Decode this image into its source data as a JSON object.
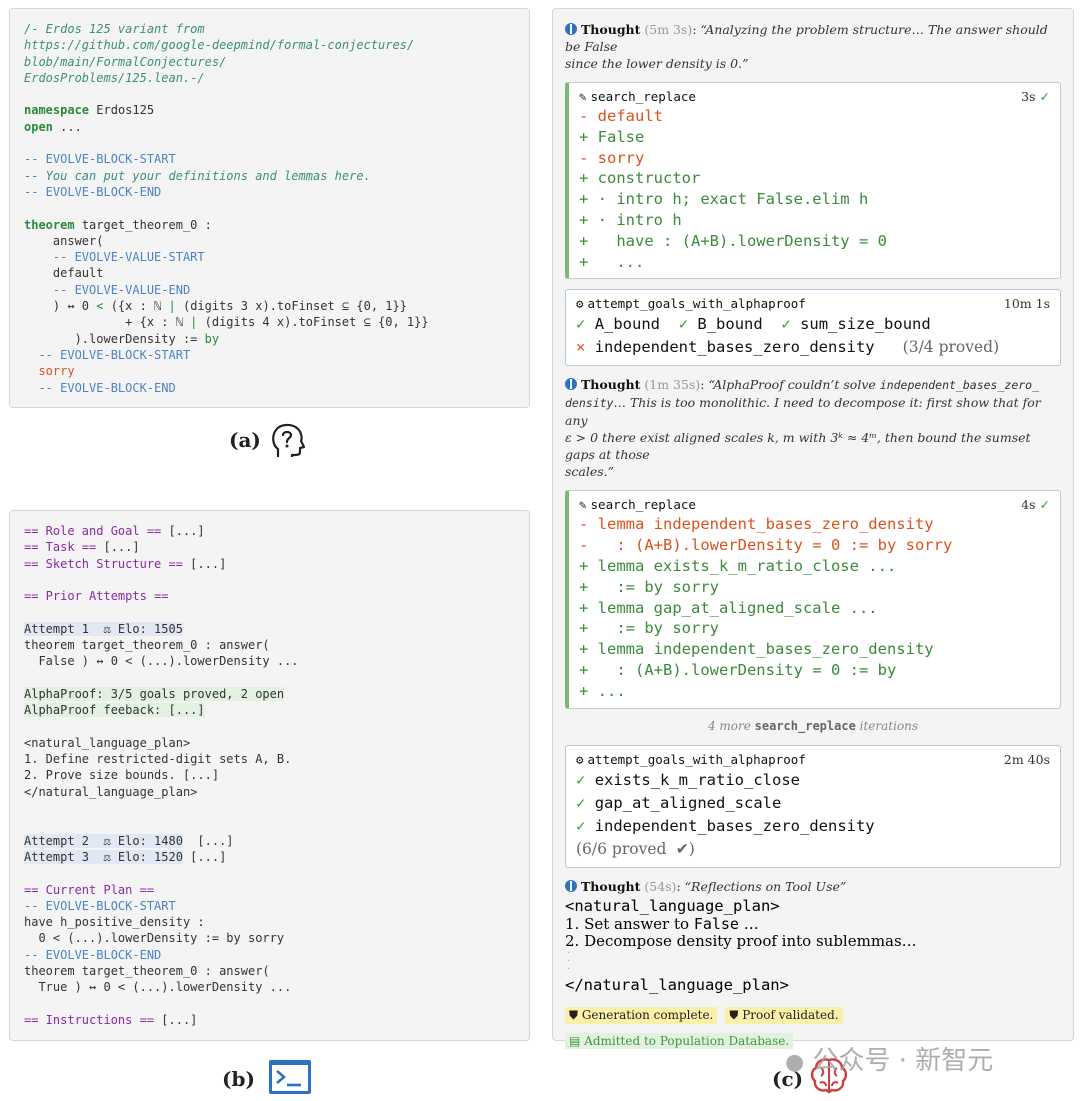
{
  "panel_a": {
    "header_comment": [
      "/- Erdos 125 variant from",
      "https://github.com/google-deepmind/formal-conjectures/",
      "blob/main/FormalConjectures/",
      "ErdosProblems/125.lean.-/"
    ],
    "namespace_kw": "namespace",
    "namespace_name": "Erdos125",
    "open_kw": "open",
    "open_rest": "...",
    "evolve_start": "-- EVOLVE-BLOCK-START",
    "evolve_comment": "-- You can put your definitions and lemmas here.",
    "evolve_end": "-- EVOLVE-BLOCK-END",
    "theorem_kw": "theorem",
    "theorem_rest": "target_theorem_0 :",
    "answer_open": "    answer(",
    "value_start": "    -- EVOLVE-VALUE-START",
    "default_line": "    default",
    "value_end": "    -- EVOLVE-VALUE-END",
    "iff_line_a": "    ) ↔ 0 ",
    "iff_line_lt": "<",
    "iff_line_b": " ({x : ℕ ",
    "iff_line_bar": "|",
    "iff_line_c": " (digits 3 x).toFinset ⊆ {0, 1}}",
    "plus_line_a": "              + {x : ℕ ",
    "plus_line_bar": "|",
    "plus_line_c": " (digits 4 x).toFinset ⊆ {0, 1}}",
    "lower_line_a": "       ).lowerDensity := ",
    "lower_line_by": "by",
    "evolve_start2": "  -- EVOLVE-BLOCK-START",
    "sorry": "  sorry",
    "evolve_end2": "  -- EVOLVE-BLOCK-END"
  },
  "caption_a": "(a)",
  "panel_b": {
    "role": "== Role and Goal ==",
    "role_rest": " [...]",
    "task": "== Task ==",
    "task_rest": " [...]",
    "sketch": "== Sketch Structure ==",
    "sketch_rest": " [...]",
    "prior": "== Prior Attempts ==",
    "attempt1": "Attempt 1  ⚖ Elo: 1505",
    "attempt1_l2": "theorem target_theorem_0 : answer(",
    "attempt1_l3": "  False ) ↔ 0 < (...).lowerDensity ...",
    "alphaproof_l1": "AlphaProof: 3/5 goals proved, 2 open",
    "alphaproof_l2": "AlphaProof feeback: [...]",
    "plan_open": "<natural_language_plan>",
    "plan_l1": "1. Define restricted-digit sets A, B.",
    "plan_l2": "2. Prove size bounds. [...]",
    "plan_close": "</natural_language_plan>",
    "attempt2": "Attempt 2  ⚖ Elo: 1480",
    "attempt2_rest": "  [...]",
    "attempt3": "Attempt 3  ⚖ Elo: 1520",
    "attempt3_rest": " [...]",
    "current": "== Current Plan ==",
    "evolve_start": "-- EVOLVE-BLOCK-START",
    "have_l1": "have h_positive_density :",
    "have_l2": "  0 < (...).lowerDensity := by sorry",
    "evolve_end": "-- EVOLVE-BLOCK-END",
    "thm_l1": "theorem target_theorem_0 : answer(",
    "thm_l2": "  True ) ↔ 0 < (...).lowerDensity ...",
    "instructions": "== Instructions ==",
    "instructions_rest": " [...]"
  },
  "caption_b": "(b)",
  "panel_c": {
    "thought1": {
      "label": "Thought",
      "time": "(5m 3s)",
      "text_a": "“Analyzing the problem structure… The answer should be False",
      "text_b": "since the lower density is 0.”"
    },
    "sr1": {
      "tool": "search_replace",
      "time": "3s",
      "lines": [
        {
          "t": "- default",
          "c": "red"
        },
        {
          "t": "+ False",
          "c": "green"
        },
        {
          "t": "- sorry",
          "c": "red"
        },
        {
          "t": "+ constructor",
          "c": "green"
        },
        {
          "t": "+ · intro h; exact False.elim h",
          "c": "green"
        },
        {
          "t": "+ · intro h",
          "c": "green"
        },
        {
          "t": "+   have : (A+B).lowerDensity = 0",
          "c": "green"
        },
        {
          "t": "+   ...",
          "c": "green"
        }
      ]
    },
    "ag1": {
      "tool": "attempt_goals_with_alphaproof",
      "time": "10m 1s",
      "g1": "A_bound",
      "g2": "B_bound",
      "g3": "sum_size_bound",
      "g4": "independent_bases_zero_density",
      "proved": "(3/4 proved)"
    },
    "thought2": {
      "label": "Thought",
      "time": "(1m 35s)",
      "l1a": "“AlphaProof couldn’t solve ",
      "l1b": "independent_bases_zero_",
      "l2a": "density",
      "l2b": "… This is too monolithic. I need to decompose it: first show that for any",
      "l3": "ε > 0 there exist aligned scales k, m with 3ᵏ ≈ 4ᵐ, then bound the sumset gaps at those",
      "l4": "scales.”"
    },
    "sr2": {
      "tool": "search_replace",
      "time": "4s",
      "lines": [
        {
          "t": "- lemma independent_bases_zero_density",
          "c": "red"
        },
        {
          "t": "-   : (A+B).lowerDensity = 0 := by sorry",
          "c": "red"
        },
        {
          "t": "+ lemma exists_k_m_ratio_close ...",
          "c": "green"
        },
        {
          "t": "+   := by sorry",
          "c": "green"
        },
        {
          "t": "+ lemma gap_at_aligned_scale ...",
          "c": "green"
        },
        {
          "t": "+   := by sorry",
          "c": "green"
        },
        {
          "t": "+ lemma independent_bases_zero_density",
          "c": "green"
        },
        {
          "t": "+   : (A+B).lowerDensity = 0 := by",
          "c": "green"
        },
        {
          "t": "+ ...",
          "c": "green"
        }
      ]
    },
    "more": {
      "a": "4 more ",
      "b": "search_replace",
      "c": " iterations"
    },
    "ag2": {
      "tool": "attempt_goals_with_alphaproof",
      "time": "2m 40s",
      "g1": "exists_k_m_ratio_close",
      "g2": "gap_at_aligned_scale",
      "g3": "independent_bases_zero_density",
      "proved": "(6/6 proved"
    },
    "thought3": {
      "label": "Thought",
      "time": "(54s)",
      "text": "“Reflections on Tool Use”"
    },
    "plan_open": "<natural_language_plan>",
    "plan_l1a": "1. Set answer to ",
    "plan_l1b": "False",
    "plan_l1c": " …",
    "plan_l2": "2. Decompose density proof into sublemmas…",
    "plan_close": "</natural_language_plan>",
    "badge1": "Generation complete.",
    "badge2": "Proof validated.",
    "badge3": "Admitted to Population Database."
  },
  "caption_c": "(c)",
  "watermark": "公众号 · 新智元",
  "colors": {
    "green": "#3c8a3c",
    "red": "#d9531e",
    "blue": "#2d72c2",
    "purple": "#8a2aa8",
    "comment": "#4c83c5"
  }
}
